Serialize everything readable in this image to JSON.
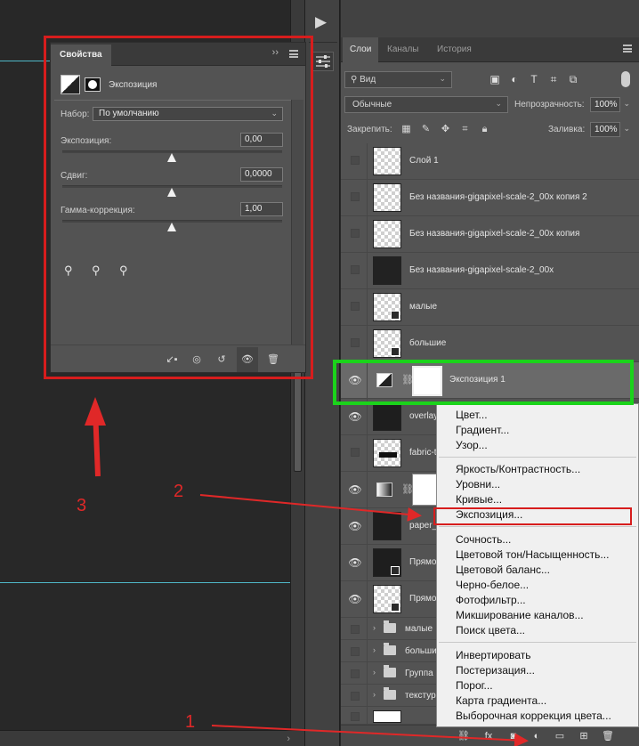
{
  "properties_panel": {
    "tab_label": "Свойства",
    "collapse_glyph": "››",
    "type_label": "Экспозиция",
    "preset_label": "Набор:",
    "preset_value": "По умолчанию",
    "exposure_label": "Экспозиция:",
    "exposure_value": "0,00",
    "offset_label": "Сдвиг:",
    "offset_value": "0,0000",
    "gamma_label": "Гамма-коррекция:",
    "gamma_value": "1,00"
  },
  "layers_panel": {
    "tabs": [
      "Слои",
      "Каналы",
      "История"
    ],
    "filter_kind": "Вид",
    "blend_mode": "Обычные",
    "opacity_label": "Непрозрачность:",
    "opacity_value": "100%",
    "lock_label": "Закрепить:",
    "fill_label": "Заливка:",
    "fill_value": "100%",
    "layers": [
      {
        "name": "Слой 1",
        "visible": false
      },
      {
        "name": "Без названия-gigapixel-scale-2_00x копия 2",
        "visible": false
      },
      {
        "name": "Без названия-gigapixel-scale-2_00x копия",
        "visible": false
      },
      {
        "name": "Без названия-gigapixel-scale-2_00x",
        "visible": false
      },
      {
        "name": "малые",
        "visible": false
      },
      {
        "name": "большие",
        "visible": false
      },
      {
        "name": "Экспозиция 1",
        "visible": true,
        "selected": true
      },
      {
        "name": "overlay",
        "visible": true
      },
      {
        "name": "fabric-t",
        "visible": false
      },
      {
        "name": "",
        "visible": true
      },
      {
        "name": "paper_",
        "visible": true
      },
      {
        "name": "Прямо",
        "visible": true
      },
      {
        "name": "Прямо",
        "visible": true
      },
      {
        "name": "малые",
        "visible": false,
        "group": true
      },
      {
        "name": "больши",
        "visible": false,
        "group": true
      },
      {
        "name": "Группа",
        "visible": false,
        "group": true
      },
      {
        "name": "текстур",
        "visible": false,
        "group": true
      }
    ],
    "bottom_icons": [
      "link-icon",
      "fx-icon",
      "mask-icon",
      "adjustment-icon",
      "folder-icon",
      "new-layer-icon",
      "trash-icon"
    ],
    "fx_label": "fx"
  },
  "context_menu": {
    "group1": [
      "Цвет...",
      "Градиент...",
      "Узор..."
    ],
    "group2": [
      "Яркость/Контрастность...",
      "Уровни...",
      "Кривые...",
      "Экспозиция..."
    ],
    "group3": [
      "Сочность...",
      "Цветовой тон/Насыщенность...",
      "Цветовой баланс...",
      "Черно-белое...",
      "Фотофильтр...",
      "Микширование каналов...",
      "Поиск цвета..."
    ],
    "group4": [
      "Инвертировать",
      "Постеризация...",
      "Порог...",
      "Карта градиента...",
      "Выборочная коррекция цвета..."
    ]
  },
  "annotations": {
    "step1": "1",
    "step2": "2",
    "step3": "3",
    "highlight_color": "#d71d1d",
    "selected_highlight_color": "#1bd31b"
  }
}
